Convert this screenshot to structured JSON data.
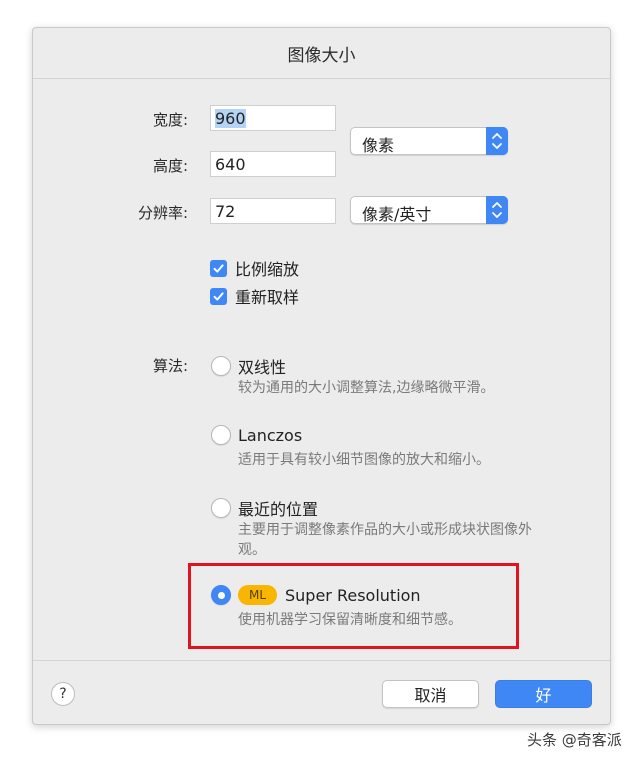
{
  "dialog": {
    "title": "图像大小",
    "width_label": "宽度:",
    "width_value": "960",
    "height_label": "高度:",
    "height_value": "640",
    "size_unit": "像素",
    "resolution_label": "分辨率:",
    "resolution_value": "72",
    "resolution_unit": "像素/英寸",
    "checkboxes": [
      {
        "label": "比例缩放",
        "checked": true
      },
      {
        "label": "重新取样",
        "checked": true
      }
    ],
    "algorithm_label": "算法:",
    "algorithms": [
      {
        "label": "双线性",
        "desc": "较为通用的大小调整算法,边缘略微平滑。",
        "selected": false
      },
      {
        "label": "Lanczos",
        "desc": "适用于具有较小细节图像的放大和缩小。",
        "selected": false
      },
      {
        "label": "最近的位置",
        "desc": "主要用于调整像素作品的大小或形成块状图像外观。",
        "selected": false
      },
      {
        "label": "Super Resolution",
        "badge": "ML",
        "desc": "使用机器学习保留清晰度和细节感。",
        "selected": true
      }
    ],
    "help_label": "?",
    "cancel_label": "取消",
    "ok_label": "好"
  },
  "watermark": "头条 @奇客派",
  "colors": {
    "accent": "#3f87f5",
    "highlight": "#e0141f",
    "ml_badge": "#f8b600"
  }
}
